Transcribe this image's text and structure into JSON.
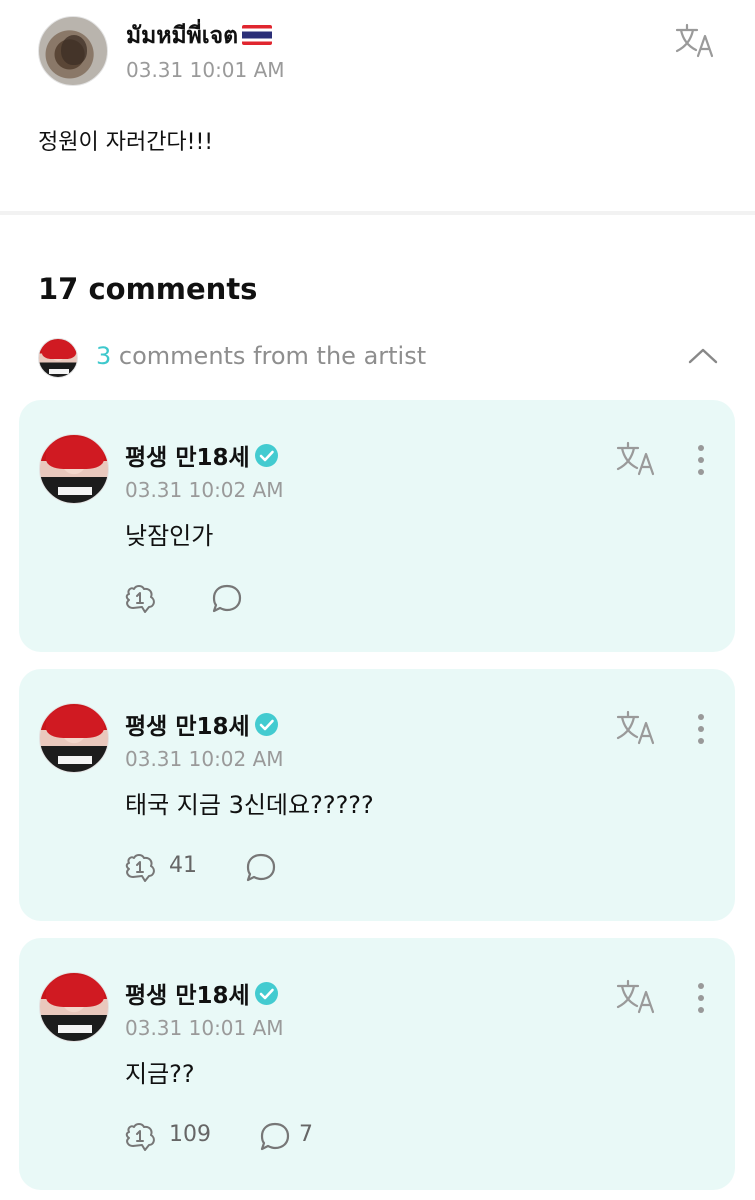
{
  "post": {
    "author": "มัมหมีพี่เจต",
    "time": "03.31 10:01 AM",
    "body": "정원이 자러간다!!!",
    "translate_icon": "translate-icon"
  },
  "comments_header": {
    "count_label": "17 comments",
    "artist_count": "3",
    "artist_label": " comments from the artist"
  },
  "comments": [
    {
      "author": "평생 만18세",
      "time": "03.31 10:02 AM",
      "body": "낮잠인가",
      "likes": "",
      "replies": ""
    },
    {
      "author": "평생 만18세",
      "time": "03.31 10:02 AM",
      "body": "태국 지금 3신데요?????",
      "likes": "41",
      "replies": ""
    },
    {
      "author": "평생 만18세",
      "time": "03.31 10:01 AM",
      "body": "지금??",
      "likes": "109",
      "replies": "7"
    }
  ],
  "colors": {
    "card_bg": "#e9f9f7",
    "accent": "#3dc8cc",
    "muted_text": "#9a9a9a"
  }
}
